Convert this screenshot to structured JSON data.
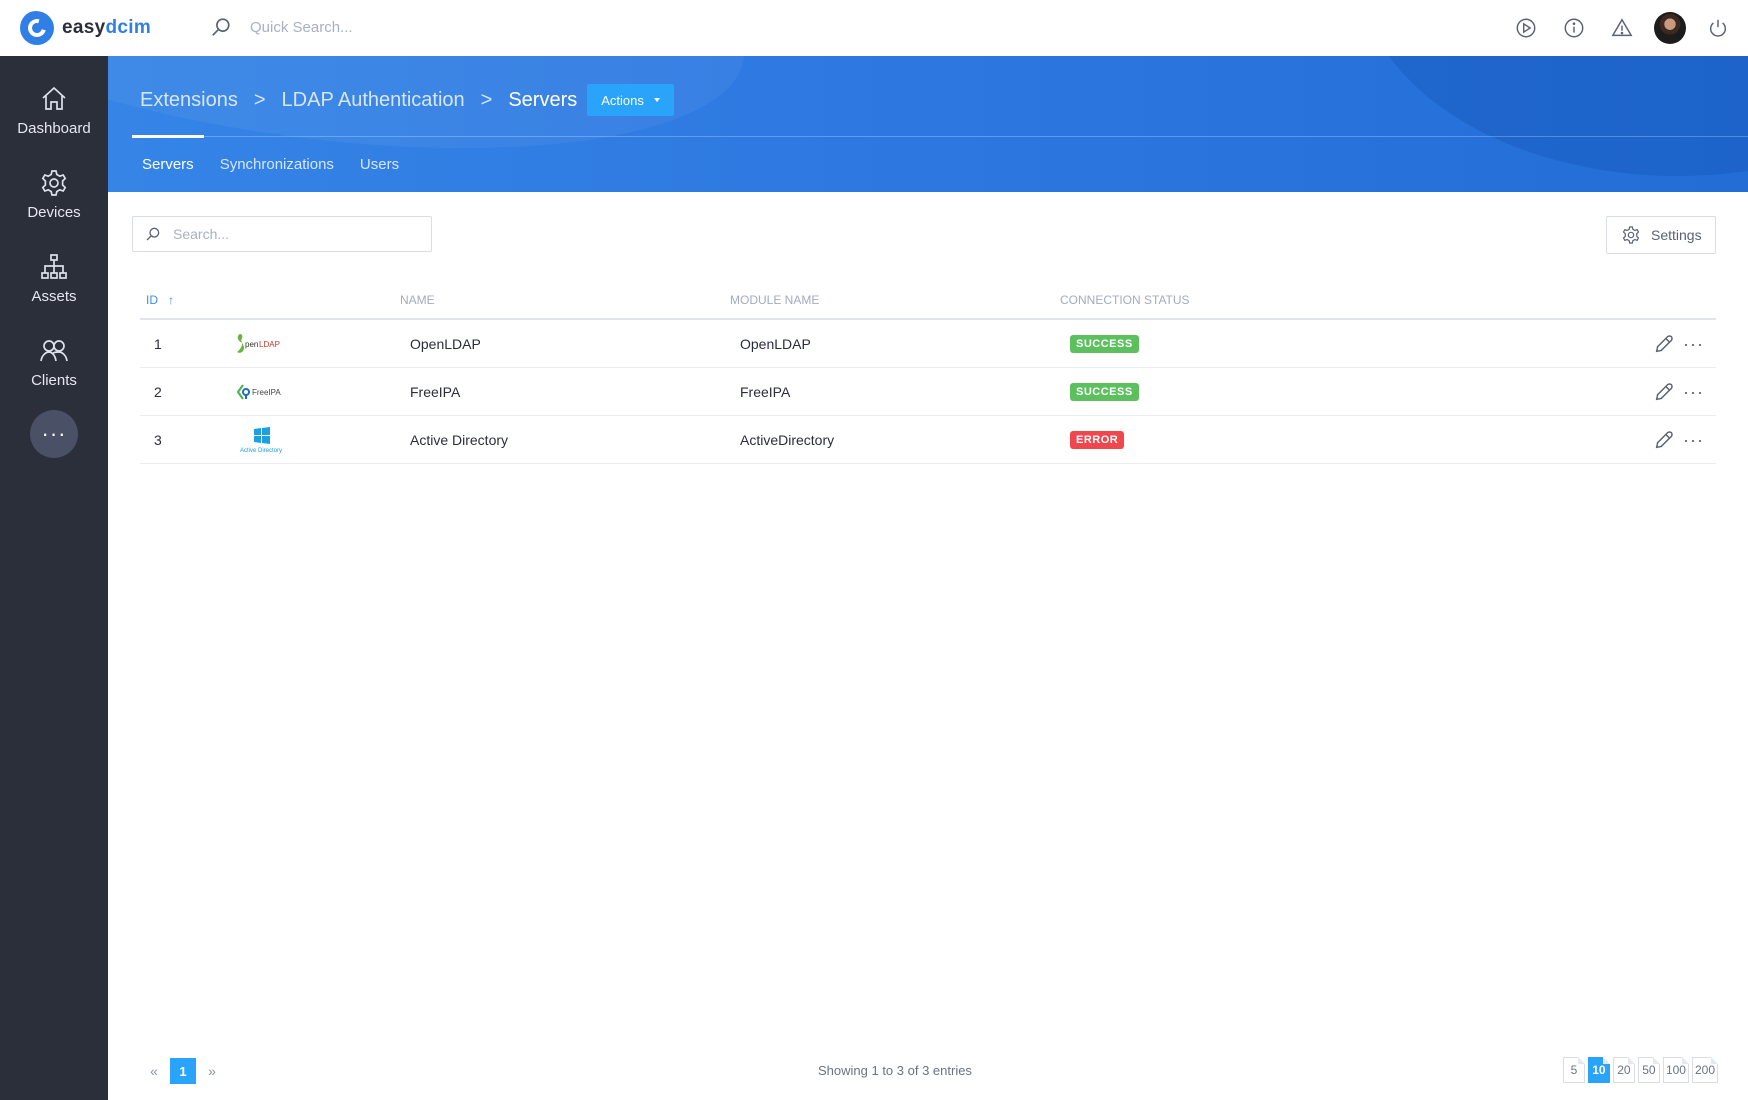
{
  "app": {
    "brand_part1": "easy",
    "brand_part2": "dcim",
    "quick_search_placeholder": "Quick Search..."
  },
  "topbar_icons": [
    "play-circle-icon",
    "info-icon",
    "warning-icon",
    "user-avatar",
    "power-icon"
  ],
  "sidebar": {
    "items": [
      {
        "label": "Dashboard",
        "icon": "home-icon"
      },
      {
        "label": "Devices",
        "icon": "gear-icon"
      },
      {
        "label": "Assets",
        "icon": "sitemap-icon"
      },
      {
        "label": "Clients",
        "icon": "users-icon"
      }
    ],
    "more_label": "···"
  },
  "breadcrumb": {
    "items": [
      "Extensions",
      "LDAP Authentication",
      "Servers"
    ],
    "separator": ">",
    "actions_label": "Actions"
  },
  "tabs": [
    {
      "label": "Servers",
      "active": true
    },
    {
      "label": "Synchronizations",
      "active": false
    },
    {
      "label": "Users",
      "active": false
    }
  ],
  "toolbar": {
    "search_placeholder": "Search...",
    "search_value": "",
    "settings_label": "Settings"
  },
  "table": {
    "columns": {
      "id": "ID",
      "id_sort": "↑",
      "name": "NAME",
      "module": "MODULE NAME",
      "status": "CONNECTION STATUS"
    },
    "rows": [
      {
        "id": "1",
        "logo": "openldap-logo",
        "logo_text": "OpenLDAP",
        "name": "OpenLDAP",
        "module": "OpenLDAP",
        "status": "SUCCESS",
        "status_color": "#5cc05f"
      },
      {
        "id": "2",
        "logo": "freeipa-logo",
        "logo_text": "FreeIPA",
        "name": "FreeIPA",
        "module": "FreeIPA",
        "status": "SUCCESS",
        "status_color": "#5cc05f"
      },
      {
        "id": "3",
        "logo": "active-directory-logo",
        "logo_text": "Active Directory",
        "name": "Active Directory",
        "module": "ActiveDirectory",
        "status": "ERROR",
        "status_color": "#f0464d"
      }
    ],
    "more_label": "···"
  },
  "footer": {
    "prev": "«",
    "current_page": "1",
    "next": "»",
    "entries_text": "Showing 1 to 3 of 3 entries",
    "per_page_options": [
      "5",
      "10",
      "20",
      "50",
      "100",
      "200"
    ],
    "per_page_selected": "10"
  },
  "colors": {
    "accent": "#2aa4fb",
    "header_blue": "#2e7ae2",
    "sidebar_bg": "#2b2f3a",
    "success": "#5cc05f",
    "error": "#f0464d"
  }
}
